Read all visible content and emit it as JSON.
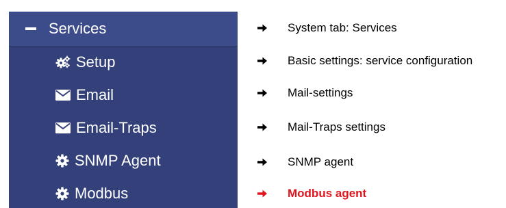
{
  "colors": {
    "menu_background": "#33407a",
    "menu_header_background": "#3c4c8a",
    "menu_text": "#ffffff",
    "annotation_text": "#000000",
    "annotation_highlight": "#e0141e"
  },
  "menu": {
    "header": {
      "label": "Services",
      "icon": "minus-icon"
    },
    "items": [
      {
        "label": "Setup",
        "icon": "gears-icon"
      },
      {
        "label": "Email",
        "icon": "envelope-icon"
      },
      {
        "label": "Email-Traps",
        "icon": "envelope-icon"
      },
      {
        "label": "SNMP Agent",
        "icon": "gear-icon"
      },
      {
        "label": "Modbus",
        "icon": "gear-icon"
      }
    ]
  },
  "annotations": [
    {
      "text": "System tab: Services",
      "highlight": false
    },
    {
      "text": "Basic settings: service configuration",
      "highlight": false
    },
    {
      "text": "Mail-settings",
      "highlight": false
    },
    {
      "text": "Mail-Traps settings",
      "highlight": false
    },
    {
      "text": "SNMP agent",
      "highlight": false
    },
    {
      "text": "Modbus agent",
      "highlight": true
    }
  ]
}
